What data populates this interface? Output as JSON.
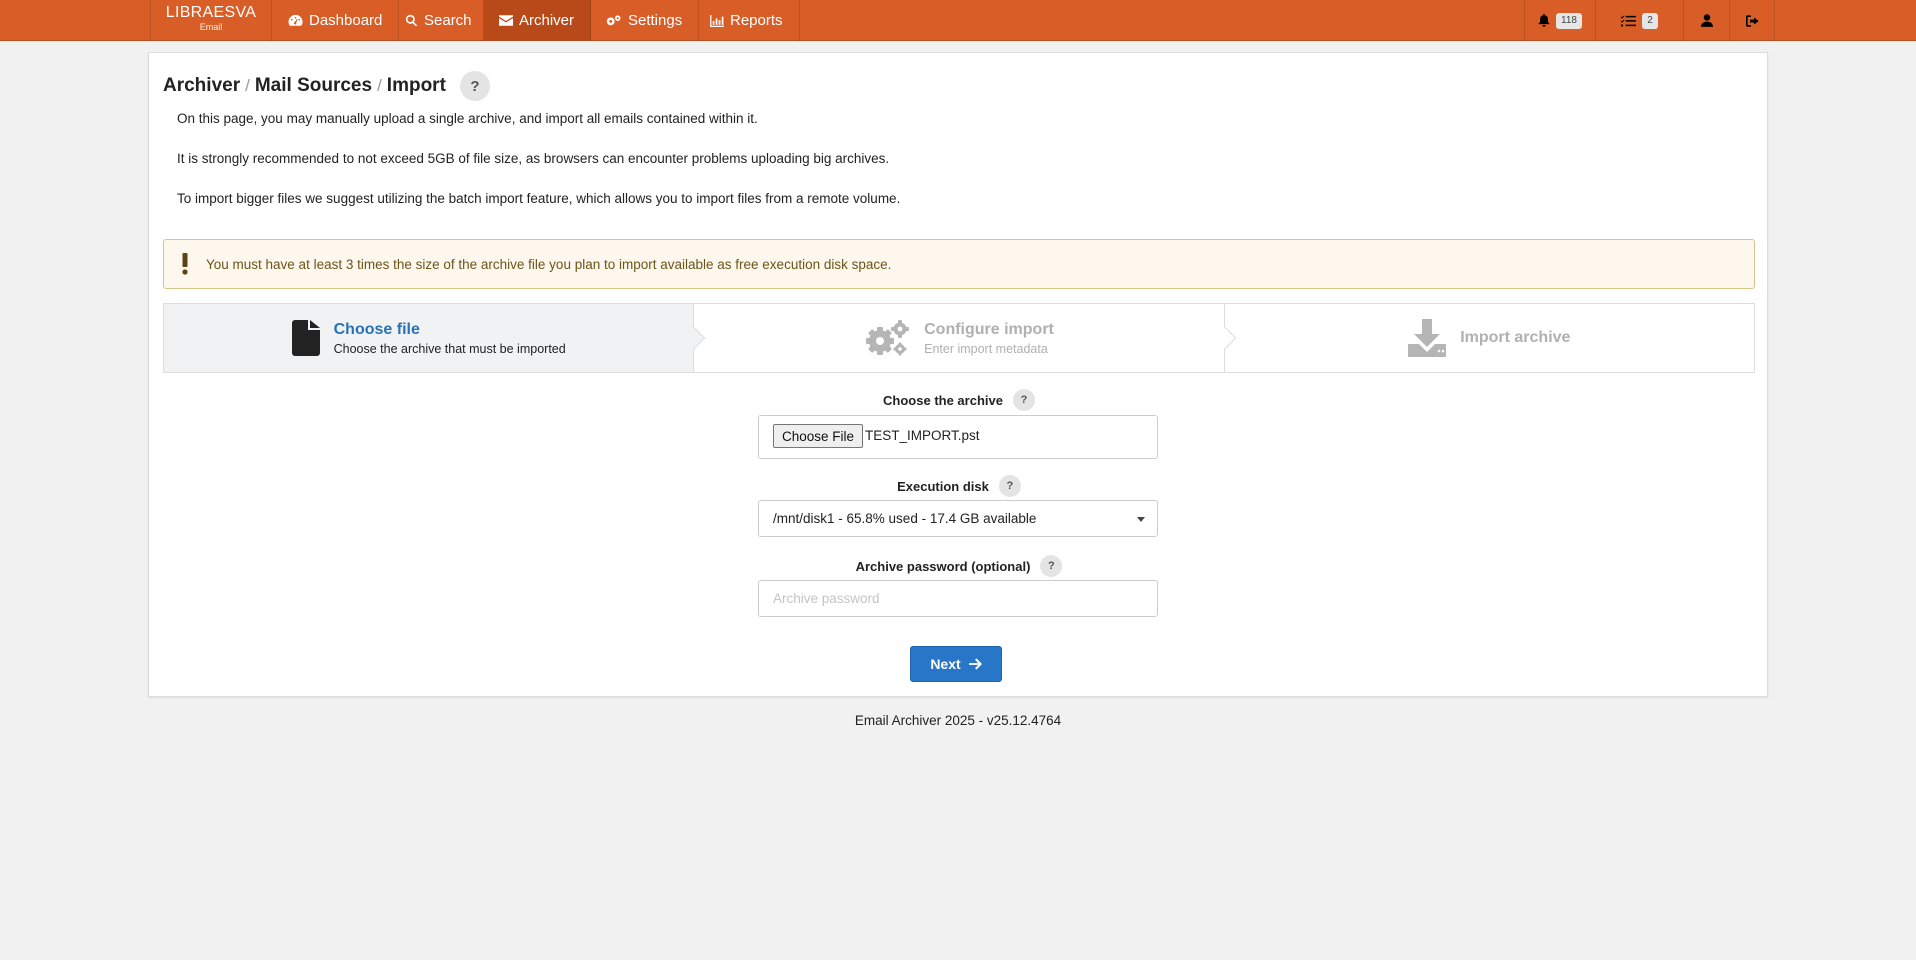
{
  "brand": {
    "name": "LIBRAESVA",
    "sub": "Email"
  },
  "nav": {
    "items": [
      {
        "label": "Dashboard",
        "icon": "dashboard-icon"
      },
      {
        "label": "Search",
        "icon": "search-icon"
      },
      {
        "label": "Archiver",
        "icon": "envelope-icon",
        "active": true
      },
      {
        "label": "Settings",
        "icon": "cogs-icon"
      },
      {
        "label": "Reports",
        "icon": "chart-icon"
      }
    ],
    "notifications_count": "118",
    "tasks_count": "2",
    "accent": "#d95d26"
  },
  "breadcrumb": [
    "Archiver",
    "Mail Sources",
    "Import"
  ],
  "breadcrumb_sep": "/",
  "help_label": "?",
  "intro": [
    "On this page, you may manually upload a single archive, and import all emails contained within it.",
    "It is strongly recommended to not exceed 5GB of file size, as browsers can encounter problems uploading big archives.",
    "To import bigger files we suggest utilizing the batch import feature, which allows you to import files from a remote volume."
  ],
  "alert": "You must have at least 3 times the size of the archive file you plan to import available as free execution disk space.",
  "wizard": {
    "steps": [
      {
        "title": "Choose file",
        "subtitle": "Choose the archive that must be imported",
        "icon": "file-icon",
        "active": true
      },
      {
        "title": "Configure import",
        "subtitle": "Enter import metadata",
        "icon": "cogs-icon",
        "active": false
      },
      {
        "title": "Import archive",
        "subtitle": "",
        "icon": "download-icon",
        "active": false
      }
    ]
  },
  "form": {
    "archive_label": "Choose the archive",
    "file_button": "Choose File",
    "file_name": "TEST_IMPORT.pst",
    "disk_label": "Execution disk",
    "disk_value": "/mnt/disk1 - 65.8% used - 17.4 GB available",
    "password_label": "Archive password (optional)",
    "password_placeholder": "Archive password",
    "next_label": "Next"
  },
  "footer": "Email Archiver 2025 - v25.12.4764"
}
